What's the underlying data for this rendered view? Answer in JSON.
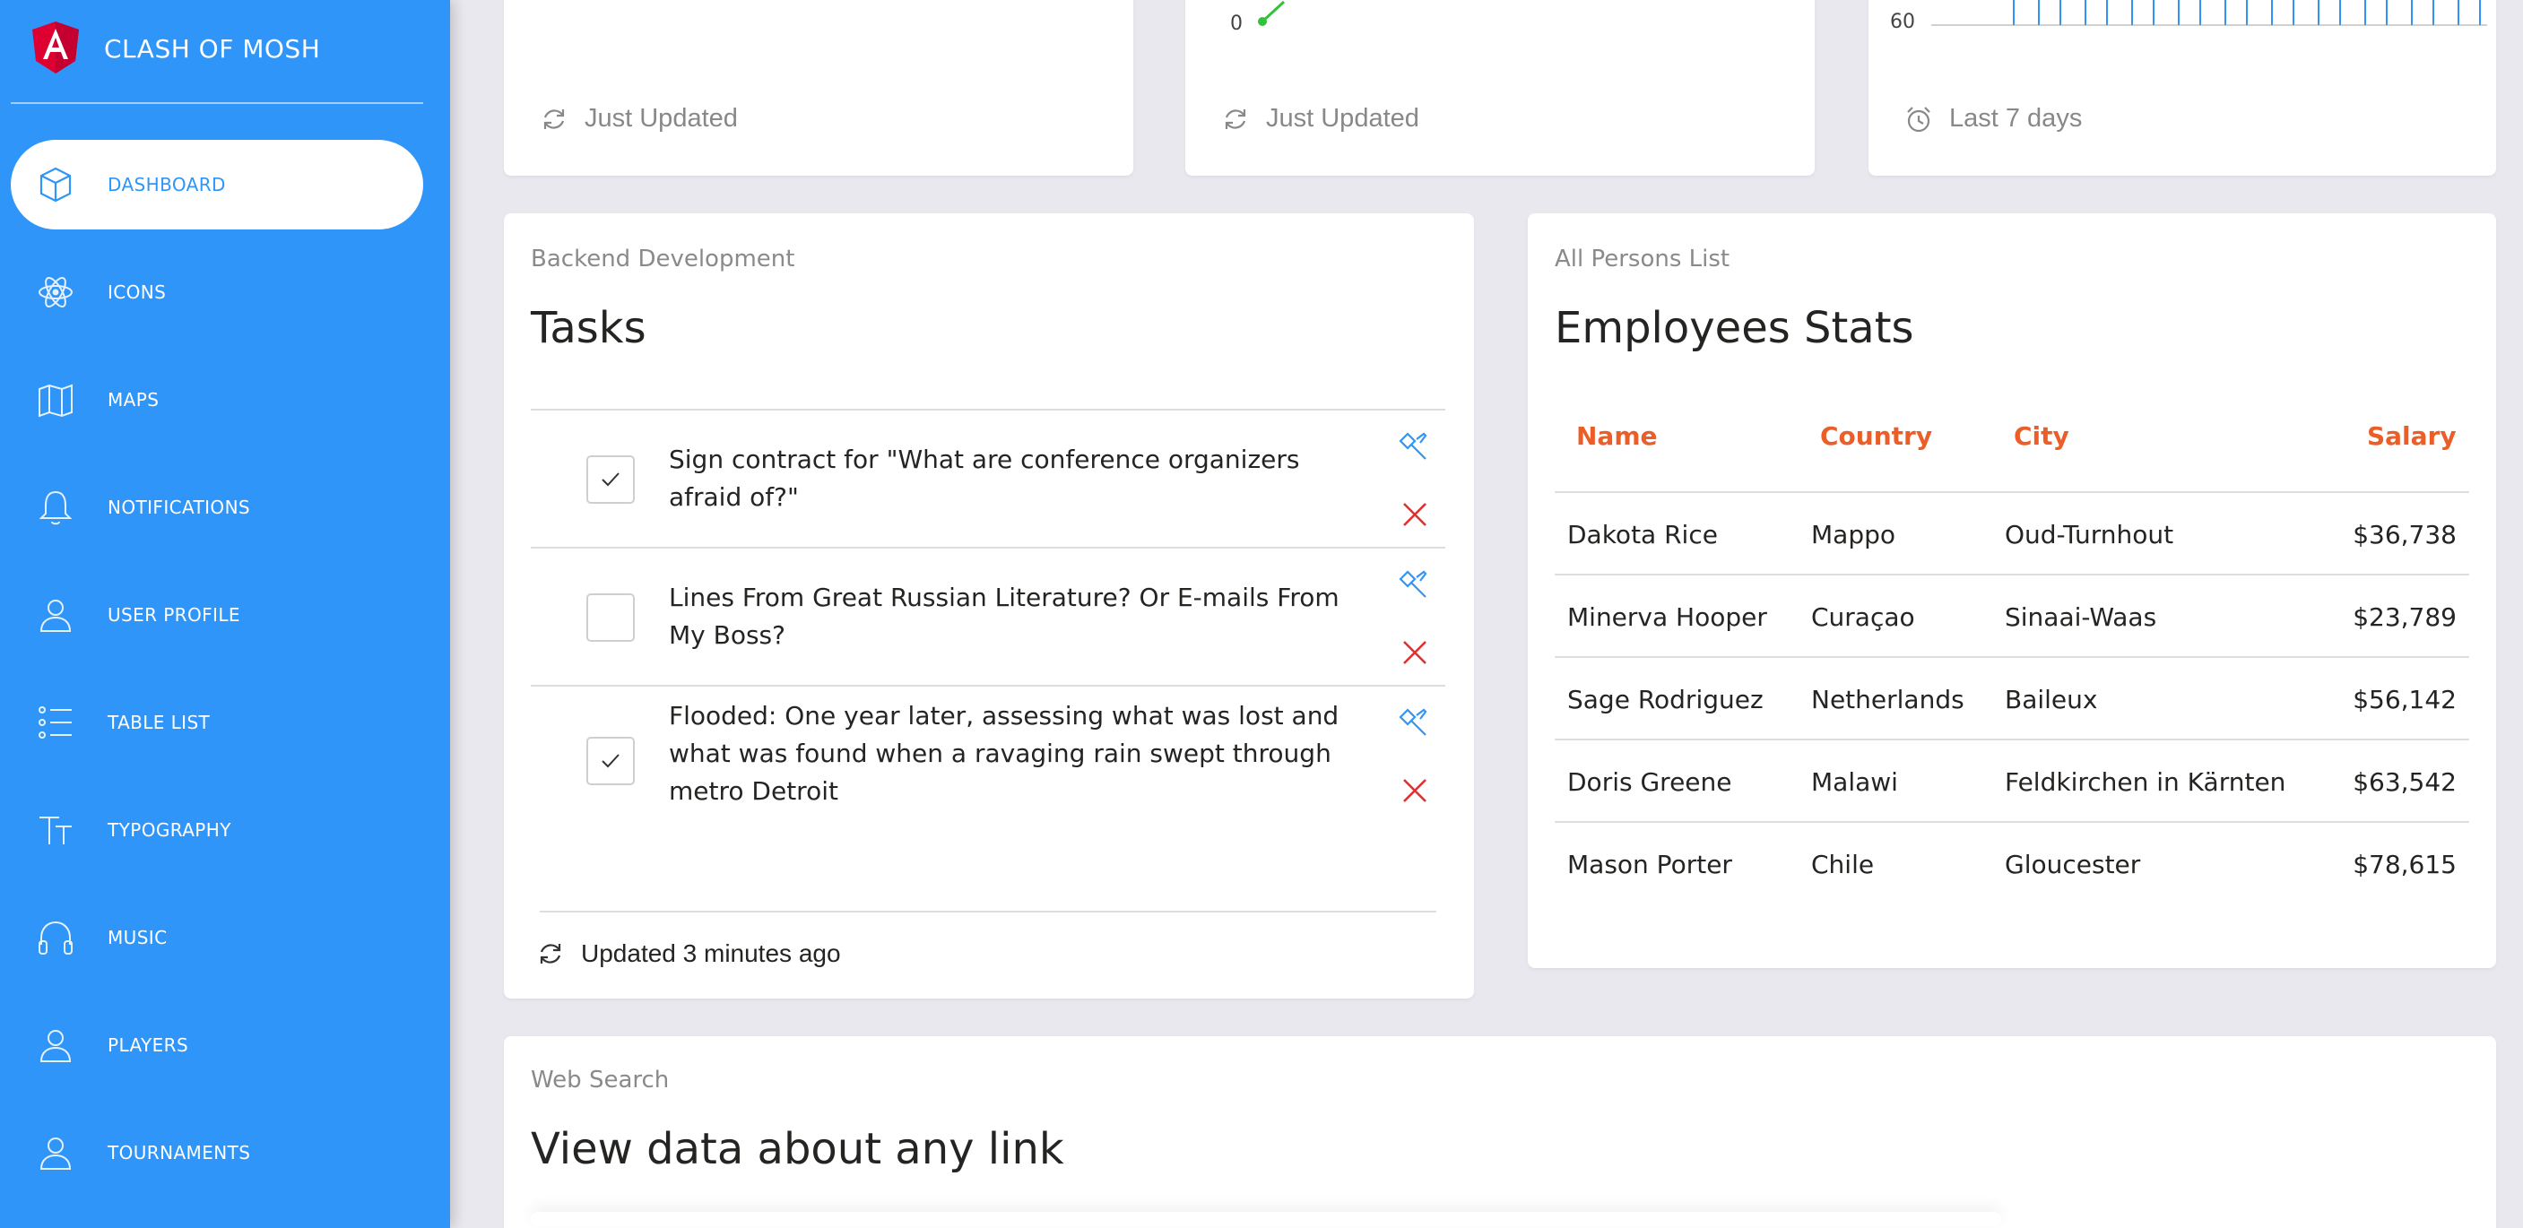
{
  "brand": {
    "name": "CLASH OF MOSH"
  },
  "colors": {
    "sidebar": "#2f95f8",
    "accent": "#eb5e28",
    "delete": "#e03030",
    "edit": "#2f95f8"
  },
  "nav": {
    "items": [
      {
        "label": "DASHBOARD",
        "icon": "box-icon",
        "active": true
      },
      {
        "label": "ICONS",
        "icon": "atom-icon"
      },
      {
        "label": "MAPS",
        "icon": "map-icon"
      },
      {
        "label": "NOTIFICATIONS",
        "icon": "bell-icon"
      },
      {
        "label": "USER PROFILE",
        "icon": "user-icon"
      },
      {
        "label": "TABLE LIST",
        "icon": "list-icon"
      },
      {
        "label": "TYPOGRAPHY",
        "icon": "text-icon"
      },
      {
        "label": "MUSIC",
        "icon": "headphones-icon"
      },
      {
        "label": "PLAYERS",
        "icon": "user-icon"
      },
      {
        "label": "TOURNAMENTS",
        "icon": "user-icon"
      }
    ]
  },
  "stat_cards": [
    {
      "footer": "Just Updated",
      "icon": "refresh-icon"
    },
    {
      "footer": "Just Updated",
      "icon": "refresh-icon",
      "axis_value": "0"
    },
    {
      "footer": "Last 7 days",
      "icon": "alarm-icon",
      "axis_value": "60"
    }
  ],
  "tasks": {
    "category": "Backend Development",
    "title": "Tasks",
    "items": [
      {
        "text": "Sign contract for \"What are conference organizers afraid of?\"",
        "checked": true
      },
      {
        "text": "Lines From Great Russian Literature? Or E-mails From My Boss?",
        "checked": false
      },
      {
        "text": "Flooded: One year later, assessing what was lost and what was found when a ravaging rain swept through metro Detroit",
        "checked": true
      }
    ],
    "footer": "Updated 3 minutes ago"
  },
  "employees": {
    "category": "All Persons List",
    "title": "Employees Stats",
    "headers": {
      "name": "Name",
      "country": "Country",
      "city": "City",
      "salary": "Salary"
    },
    "rows": [
      {
        "name": "Dakota Rice",
        "country": "Mappo",
        "city": "Oud-Turnhout",
        "salary": "$36,738"
      },
      {
        "name": "Minerva Hooper",
        "country": "Curaçao",
        "city": "Sinaai-Waas",
        "salary": "$23,789"
      },
      {
        "name": "Sage Rodriguez",
        "country": "Netherlands",
        "city": "Baileux",
        "salary": "$56,142"
      },
      {
        "name": "Doris Greene",
        "country": "Malawi",
        "city": "Feldkirchen in Kärnten",
        "salary": "$63,542"
      },
      {
        "name": "Mason Porter",
        "country": "Chile",
        "city": "Gloucester",
        "salary": "$78,615"
      }
    ]
  },
  "web_search": {
    "category": "Web Search",
    "title": "View data about any link"
  }
}
